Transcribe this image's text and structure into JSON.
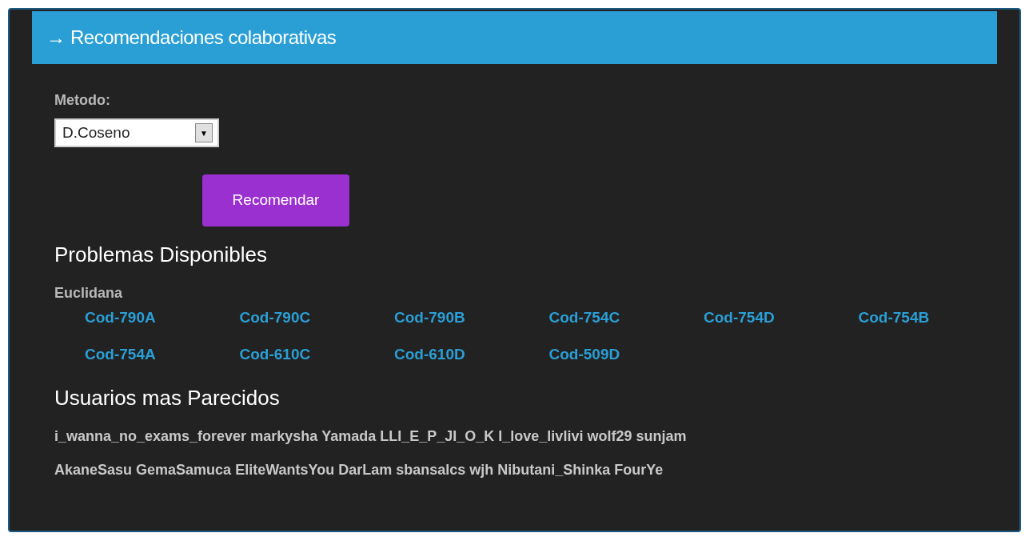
{
  "panel": {
    "title_icon": "→",
    "title": "Recomendaciones colaborativas"
  },
  "method": {
    "label": "Metodo:",
    "value": "D.Coseno",
    "arrow": "▼"
  },
  "recommend_button": "Recomendar",
  "problems": {
    "heading": "Problemas Disponibles",
    "group": "Euclidana",
    "items": [
      "Cod-790A",
      "Cod-790C",
      "Cod-790B",
      "Cod-754C",
      "Cod-754D",
      "Cod-754B",
      "Cod-754A",
      "Cod-610C",
      "Cod-610D",
      "Cod-509D"
    ]
  },
  "users": {
    "heading": "Usuarios mas Parecidos",
    "lines": [
      [
        "i_wanna_no_exams_forever",
        "markysha",
        "Yamada",
        "LLI_E_P_JI_O_K",
        "I_love_livlivi",
        "wolf29",
        "sunjam"
      ],
      [
        "AkaneSasu",
        "GemaSamuca",
        "EliteWantsYou",
        "DarLam",
        "sbansalcs",
        "wjh",
        "Nibutani_Shinka",
        "FourYe"
      ]
    ]
  }
}
